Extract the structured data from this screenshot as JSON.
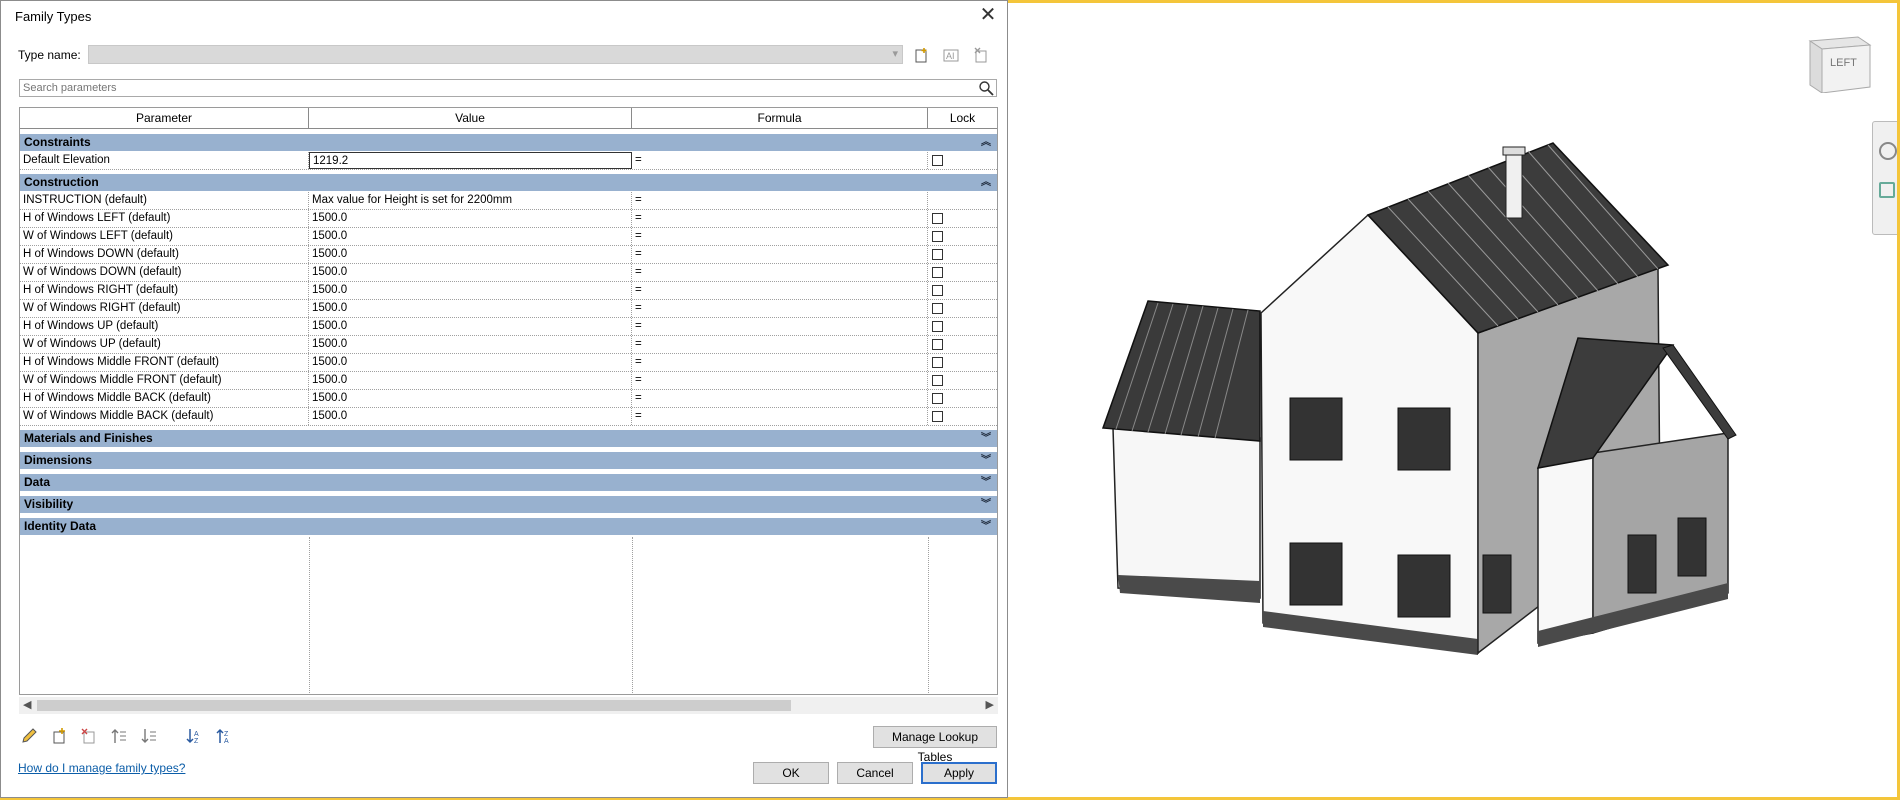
{
  "dialog": {
    "title": "Family Types",
    "type_name_label": "Type name:",
    "type_name_value": "",
    "search_placeholder": "Search parameters"
  },
  "columns": [
    "Parameter",
    "Value",
    "Formula",
    "Lock"
  ],
  "groups": {
    "constraints": "Constraints",
    "construction": "Construction",
    "materials": "Materials and Finishes",
    "dimensions": "Dimensions",
    "data": "Data",
    "visibility": "Visibility",
    "identity": "Identity Data"
  },
  "constraints_rows": [
    {
      "param": "Default Elevation",
      "value": "1219.2",
      "formula": "=",
      "lock": false
    }
  ],
  "construction_rows": [
    {
      "param": "INSTRUCTION (default)",
      "value": "Max value for Height is set for 2200mm",
      "formula": "="
    },
    {
      "param": "H of Windows LEFT (default)",
      "value": "1500.0",
      "formula": "=",
      "lock": false
    },
    {
      "param": "W of Windows LEFT (default)",
      "value": "1500.0",
      "formula": "=",
      "lock": false
    },
    {
      "param": "H of Windows DOWN (default)",
      "value": "1500.0",
      "formula": "=",
      "lock": false
    },
    {
      "param": "W of Windows DOWN (default)",
      "value": "1500.0",
      "formula": "=",
      "lock": false
    },
    {
      "param": "H of Windows RIGHT (default)",
      "value": "1500.0",
      "formula": "=",
      "lock": false
    },
    {
      "param": "W of Windows RIGHT (default)",
      "value": "1500.0",
      "formula": "=",
      "lock": false
    },
    {
      "param": "H of Windows  UP (default)",
      "value": "1500.0",
      "formula": "=",
      "lock": false
    },
    {
      "param": "W of Windows UP (default)",
      "value": "1500.0",
      "formula": "=",
      "lock": false
    },
    {
      "param": "H of Windows Middle FRONT (default)",
      "value": "1500.0",
      "formula": "=",
      "lock": false
    },
    {
      "param": "W of Windows Middle FRONT (default)",
      "value": "1500.0",
      "formula": "=",
      "lock": false
    },
    {
      "param": "H of Windows Middle BACK (default)",
      "value": "1500.0",
      "formula": "=",
      "lock": false
    },
    {
      "param": "W of Windows Middle BACK (default)",
      "value": "1500.0",
      "formula": "=",
      "lock": false
    }
  ],
  "buttons": {
    "manage_lookup": "Manage Lookup Tables",
    "ok": "OK",
    "cancel": "Cancel",
    "apply": "Apply"
  },
  "help_link": "How do I manage family types?",
  "viewcube": {
    "label": "LEFT"
  },
  "icons": {
    "edit": "pencil-icon",
    "new_param": "new-parameter-icon",
    "delete_param": "delete-parameter-icon",
    "move_up": "move-up-icon",
    "move_down": "move-down-icon",
    "sort_asc": "sort-ascending-icon",
    "sort_desc": "sort-descending-icon"
  }
}
